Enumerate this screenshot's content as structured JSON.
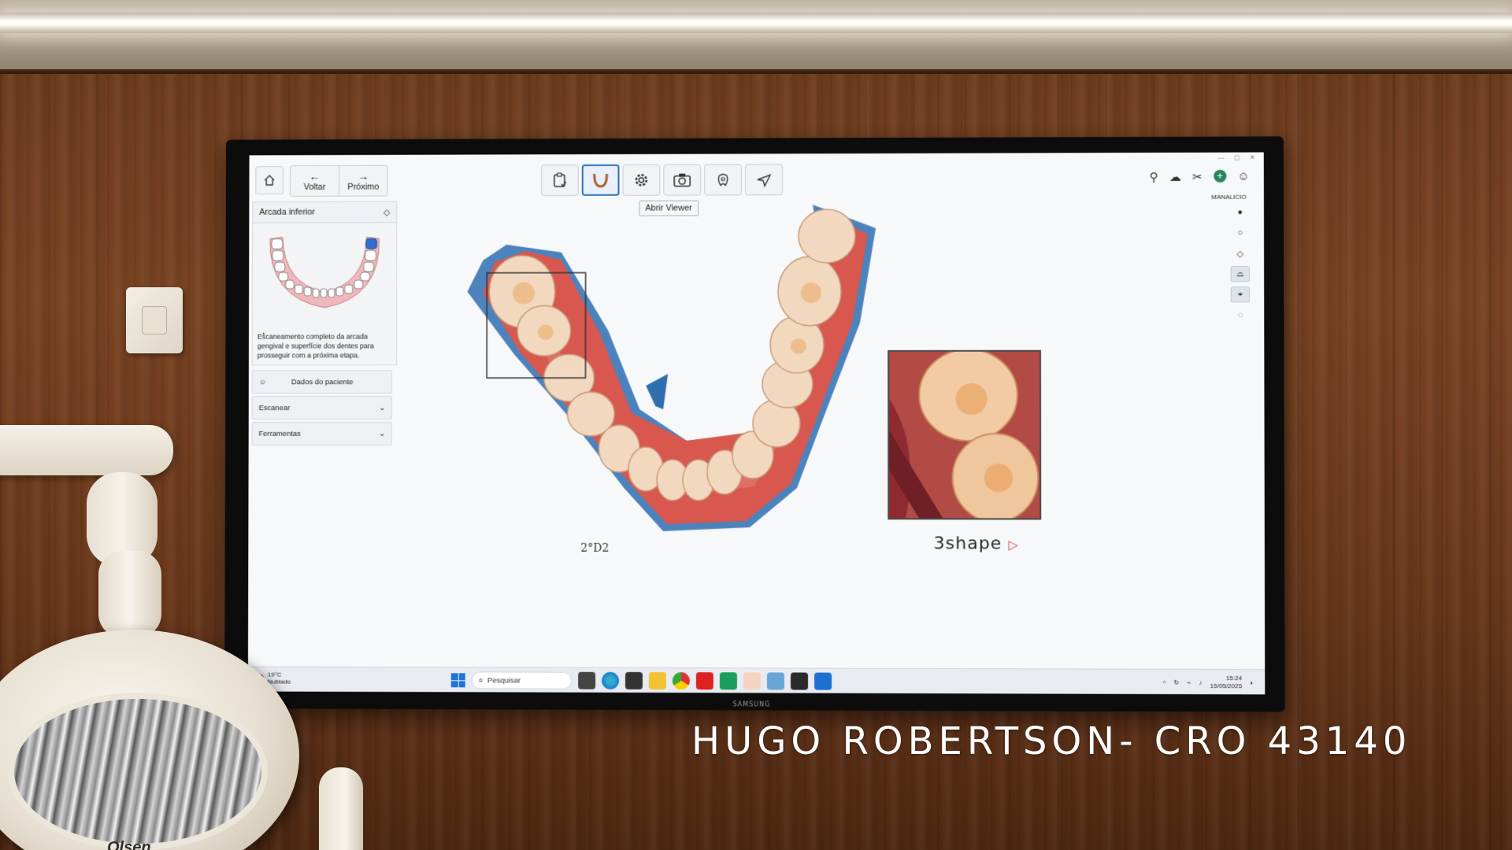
{
  "app": {
    "nav": {
      "back_label": "Voltar",
      "next_label": "Próximo"
    },
    "tooltip": "Abrir Viewer",
    "user_label": "MANALICIO",
    "panel": {
      "title": "Arcada inferior",
      "description": "Escaneamento completo da arcada gengival e superfície dos dentes para prosseguir com a próxima etapa.",
      "patient_label": "Dados do paciente",
      "scan_label": "Escanear",
      "tools_label": "Ferramentas"
    },
    "logo": "3shape",
    "bottom_mark": "2°D2"
  },
  "taskbar": {
    "weather_temp": "19°C",
    "weather_desc": "Nublado",
    "search_placeholder": "Pesquisar",
    "time": "15:24",
    "date": "15/05/2025"
  },
  "tv_brand": "SAMSUNG",
  "lamp_brand": "Olsen",
  "caption": "HUGO ROBERTSON- CRO 43140",
  "colors": {
    "gingiva": "#d8574f",
    "tooth": "#f2d8bf",
    "scan_edge": "#2f6fb0",
    "accent_active": "#2f6fbf",
    "logo_accent": "#d33a3a"
  },
  "icons": [
    "home-icon",
    "arrow-left-icon",
    "arrow-right-icon",
    "clipboard-icon",
    "jaw-icon",
    "gear-icon",
    "camera-icon",
    "tooth-analysis-icon",
    "send-icon",
    "windows-icon",
    "search-icon"
  ]
}
